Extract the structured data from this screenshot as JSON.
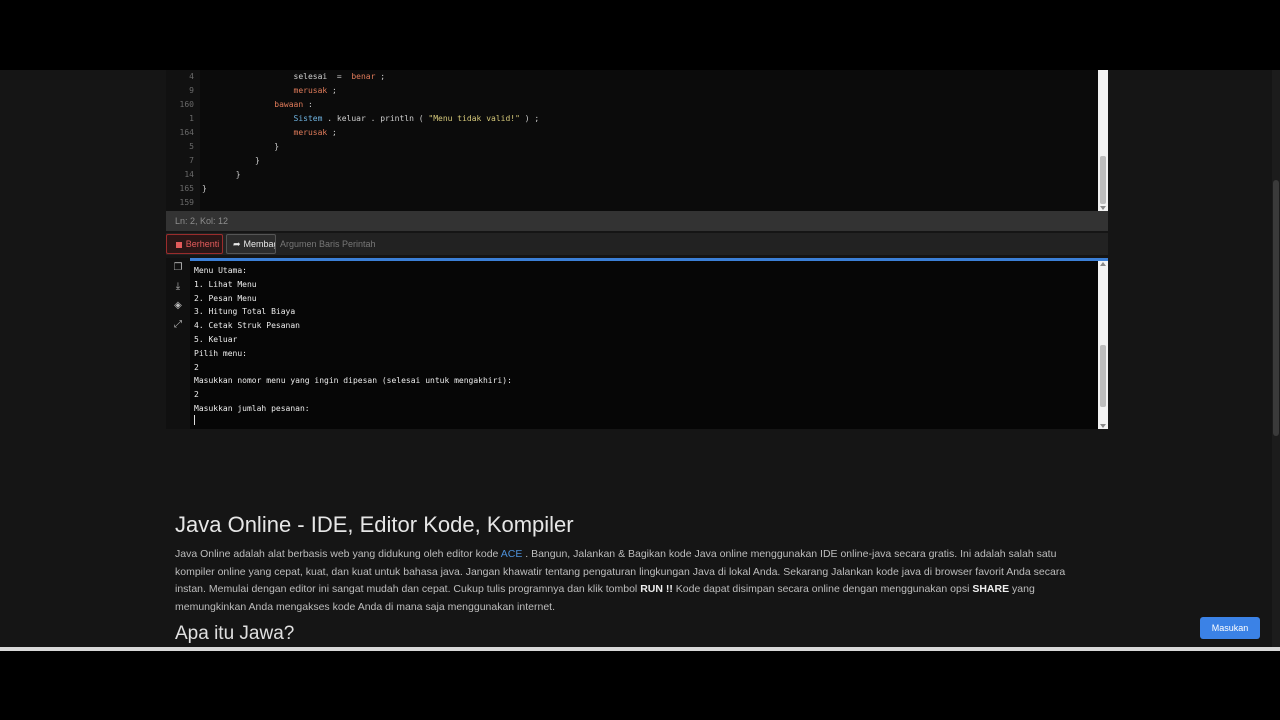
{
  "editor": {
    "lines": [
      {
        "ln": "4",
        "indent": "                   ",
        "parts": [
          [
            "",
            "selesai  =  "
          ],
          [
            "kw",
            "benar"
          ],
          [
            "",
            " ;"
          ]
        ]
      },
      {
        "ln": "9",
        "indent": "                   ",
        "parts": [
          [
            "kw",
            "merusak"
          ],
          [
            "",
            " ;"
          ]
        ]
      },
      {
        "ln": "160",
        "indent": "               ",
        "parts": [
          [
            "kw",
            "bawaan"
          ],
          [
            "",
            " :"
          ]
        ]
      },
      {
        "ln": "1",
        "indent": "                   ",
        "parts": [
          [
            "fn",
            "Sistem"
          ],
          [
            "",
            " . keluar . println ( "
          ],
          [
            "str",
            "\"Menu tidak valid!\""
          ],
          [
            "",
            " ) ;"
          ]
        ]
      },
      {
        "ln": "164",
        "indent": "                   ",
        "parts": [
          [
            "kw",
            "merusak"
          ],
          [
            "",
            " ;"
          ]
        ]
      },
      {
        "ln": "5",
        "indent": "               ",
        "parts": [
          [
            "",
            "}"
          ]
        ]
      },
      {
        "ln": "7",
        "indent": "           ",
        "parts": [
          [
            "",
            "}"
          ]
        ]
      },
      {
        "ln": "14",
        "indent": "       ",
        "parts": [
          [
            "",
            "}"
          ]
        ]
      },
      {
        "ln": "165",
        "indent": "",
        "parts": [
          [
            "",
            "}"
          ]
        ]
      },
      {
        "ln": "159",
        "indent": "",
        "parts": []
      }
    ]
  },
  "status": {
    "cursor_pos": "Ln: 2, Kol: 12"
  },
  "toolbar": {
    "stop_label": "Berhenti",
    "share_label": "Membagikan",
    "args_placeholder": "Argumen Baris Perintah"
  },
  "terminal": {
    "tools": [
      {
        "name": "copy-icon",
        "glyph": "❐"
      },
      {
        "name": "download-icon",
        "glyph": "⤓"
      },
      {
        "name": "eraser-icon",
        "glyph": "◈"
      },
      {
        "name": "expand-icon",
        "glyph": "⤢"
      }
    ],
    "lines": [
      "Menu Utama:",
      "1. Lihat Menu",
      "2. Pesan Menu",
      "3. Hitung Total Biaya",
      "4. Cetak Struk Pesanan",
      "5. Keluar",
      "Pilih menu:",
      "2",
      "Masukkan nomor menu yang ingin dipesan (selesai untuk mengakhiri):",
      "2",
      "Masukkan jumlah pesanan:"
    ]
  },
  "article": {
    "title": "Java Online - IDE, Editor Kode, Kompiler",
    "para_1": "Java Online adalah alat berbasis web yang didukung oleh editor kode ",
    "ace_link": "ACE",
    "para_2": " . Bangun, Jalankan & Bagikan kode Java online menggunakan IDE online-java secara gratis. Ini adalah salah satu kompiler online yang cepat, kuat, dan kuat untuk bahasa java. Jangan khawatir tentang pengaturan lingkungan Java di lokal Anda. Sekarang Jalankan kode java di browser favorit Anda secara instan. Memulai dengan editor ini sangat mudah dan cepat. Cukup tulis programnya dan klik tombol ",
    "run_label": "RUN !!",
    "para_3": " Kode dapat disimpan secara online dengan menggunakan opsi ",
    "share_label": "SHARE",
    "para_4": " yang memungkinkan Anda mengakses kode Anda di mana saja menggunakan internet.",
    "subtitle": "Apa itu Jawa?"
  },
  "login": {
    "label": "Masukan"
  },
  "colors": {
    "accent": "#3b82e6",
    "stop": "#e35b5b",
    "keyword": "#e07b5a",
    "string": "#d6c97a",
    "function": "#6fb3e0"
  }
}
